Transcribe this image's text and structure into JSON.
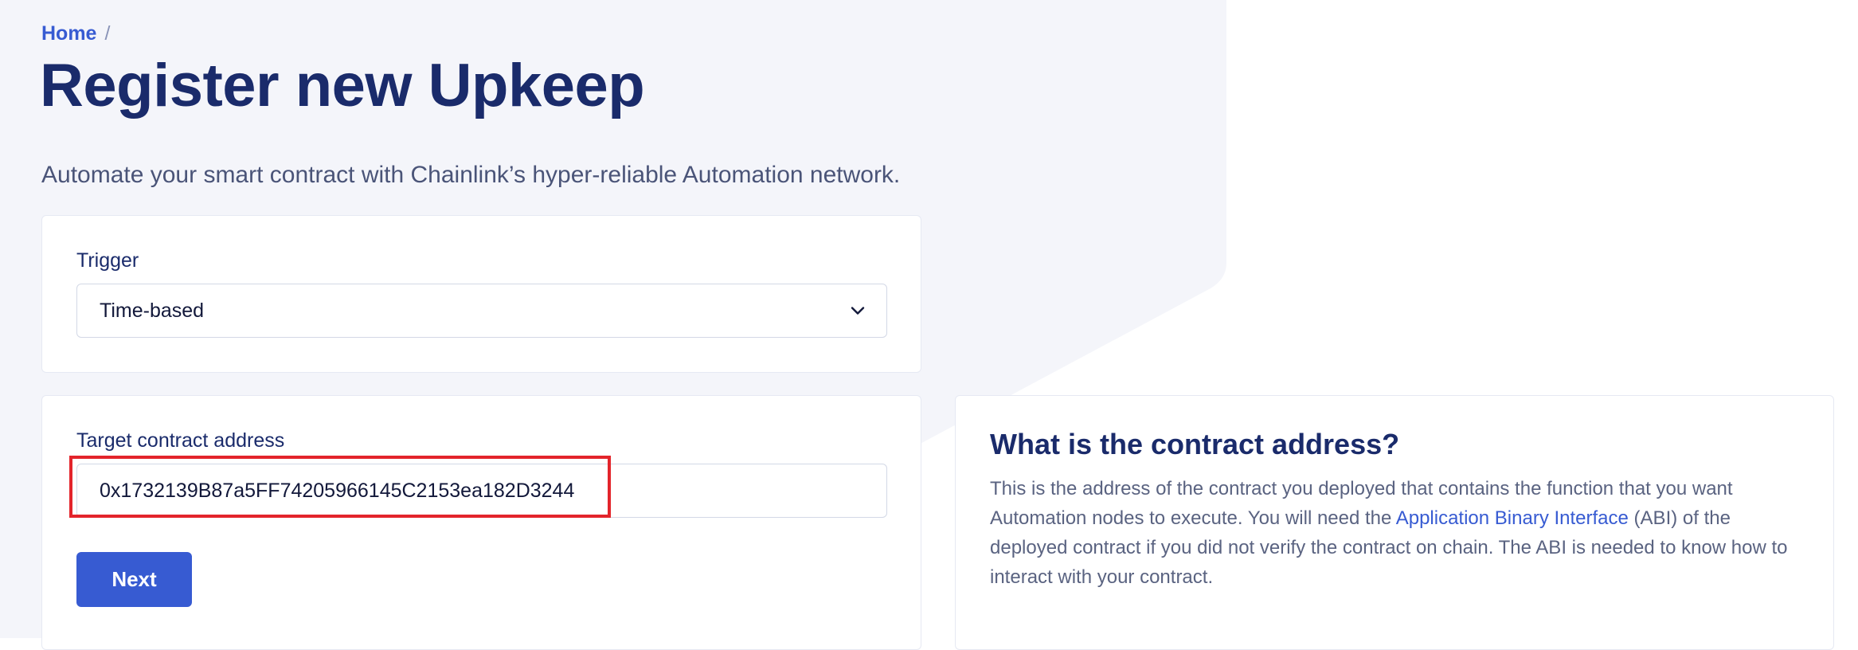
{
  "breadcrumb": {
    "home": "Home",
    "separator": "/"
  },
  "page": {
    "title": "Register new Upkeep",
    "subtitle": "Automate your smart contract with Chainlink’s hyper-reliable Automation network."
  },
  "trigger": {
    "label": "Trigger",
    "selected": "Time-based",
    "icon": "chevron-down-icon"
  },
  "target": {
    "label": "Target contract address",
    "value": "0x1732139B87a5FF74205966145C2153ea182D3244",
    "next_label": "Next"
  },
  "info": {
    "title": "What is the contract address?",
    "body_part1": "This is the address of the contract you deployed that contains the function that you want Automation nodes to execute. You will need the ",
    "link_text": "Application Binary Interface",
    "body_part2": " (ABI) of the deployed contract if you did not verify the contract on chain. The ABI is needed to know how to interact with your contract."
  },
  "colors": {
    "primary": "#375bd2",
    "title": "#1a2b6b",
    "highlight": "#e3242b",
    "background_panel": "#f4f5fa"
  }
}
